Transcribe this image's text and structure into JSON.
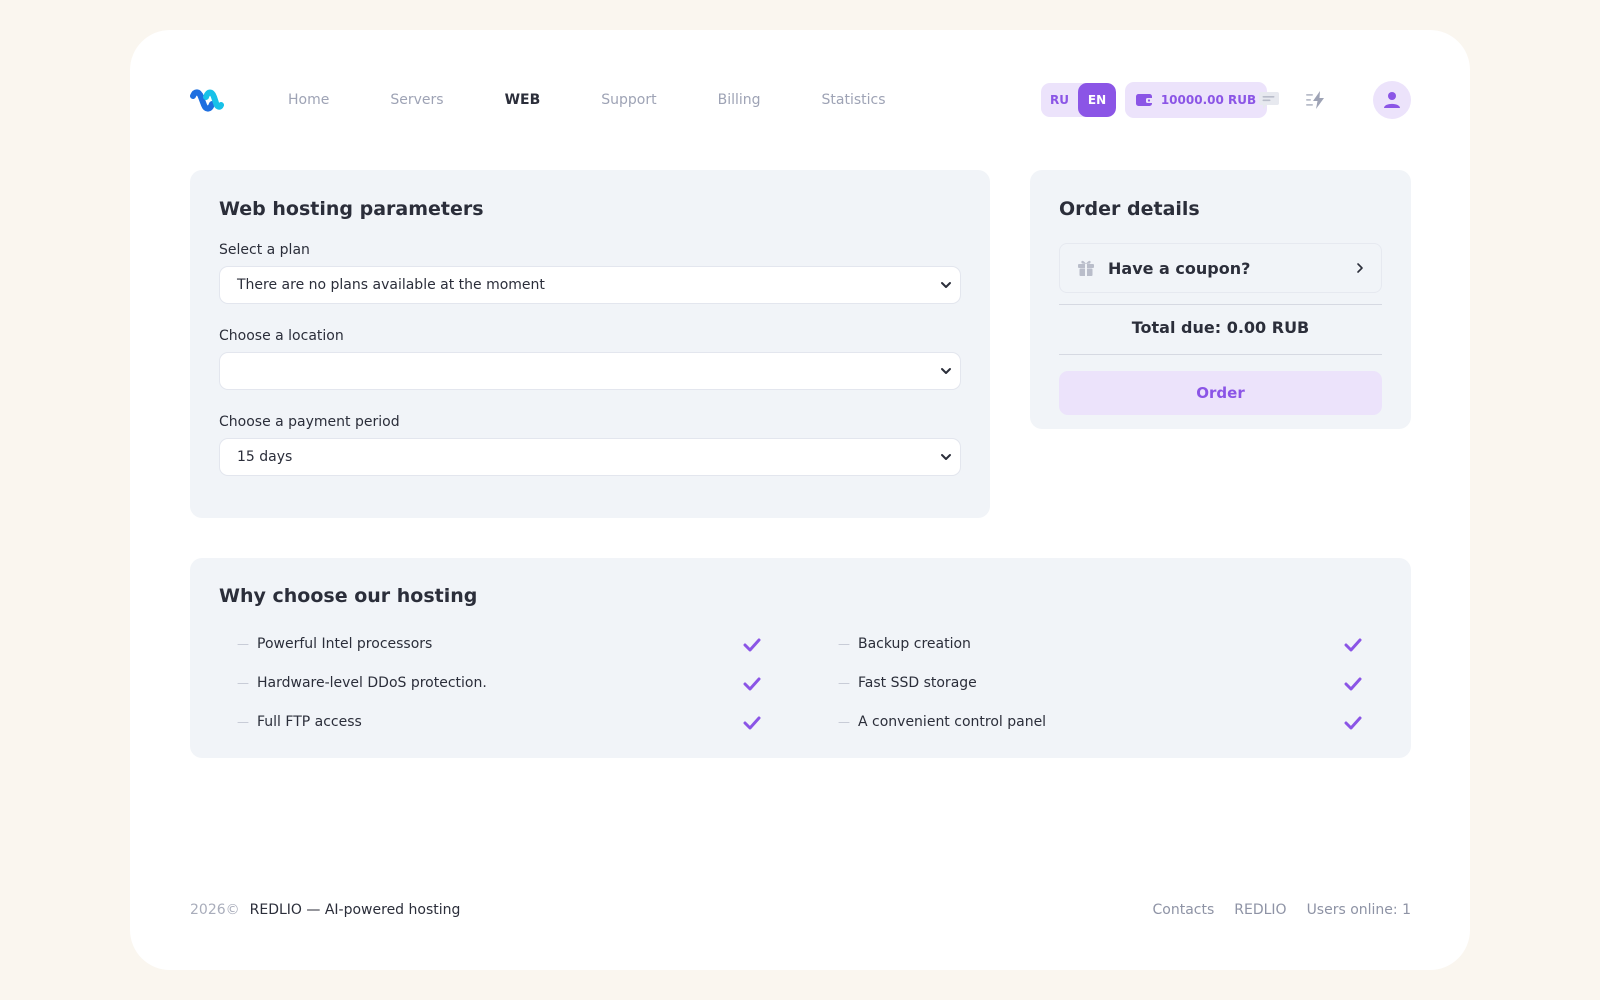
{
  "header": {
    "nav": [
      "Home",
      "Servers",
      "WEB",
      "Support",
      "Billing",
      "Statistics"
    ],
    "active_nav": "WEB",
    "lang": {
      "ru": "RU",
      "en": "EN",
      "active": "EN"
    },
    "balance": "10000.00 RUB",
    "icons": [
      "wallet-icon",
      "chat-icon",
      "lightning-icon",
      "user-icon"
    ]
  },
  "params": {
    "title": "Web hosting parameters",
    "plan_label": "Select a plan",
    "plan_value": "There are no plans available at the moment",
    "location_label": "Choose a location",
    "location_value": "",
    "period_label": "Choose a payment period",
    "period_value": "15 days"
  },
  "order": {
    "title": "Order details",
    "coupon_label": "Have a coupon?",
    "total": "Total due: 0.00 RUB",
    "button": "Order"
  },
  "why": {
    "title": "Why choose our hosting",
    "features_left": [
      "Powerful Intel processors",
      "Hardware-level DDoS protection.",
      "Full FTP access"
    ],
    "features_right": [
      "Backup creation",
      "Fast SSD storage",
      "A convenient control panel"
    ]
  },
  "footer": {
    "year": "2026©",
    "copyright": "REDLIO — AI-powered hosting",
    "links": [
      "Contacts",
      "REDLIO"
    ],
    "users_online": "Users online: 1"
  },
  "colors": {
    "accent": "#8b55e6",
    "accent_light": "#ece3fb",
    "panel": "#f1f4f8",
    "page_bg": "#faf6ef",
    "logo_blue": "#1e6fe0",
    "logo_cyan": "#18c1e8"
  }
}
